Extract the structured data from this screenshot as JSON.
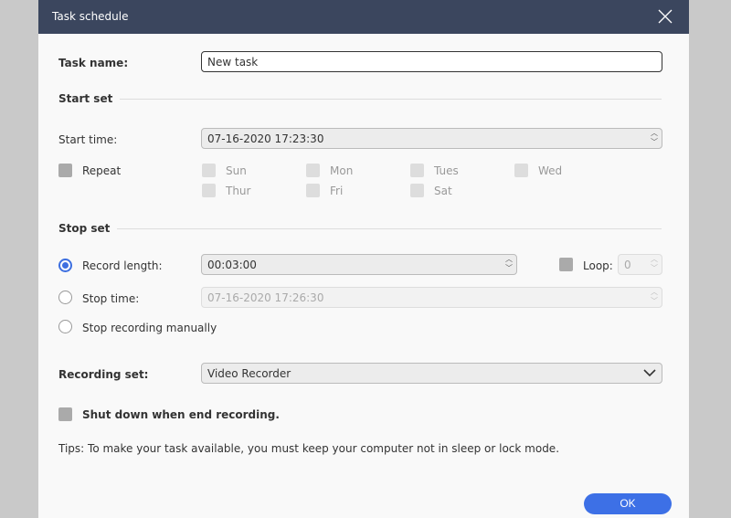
{
  "window": {
    "title": "Task schedule"
  },
  "task_name": {
    "label": "Task name:",
    "value": "New task"
  },
  "start_set": {
    "heading": "Start set",
    "start_time_label": "Start time:",
    "start_time_value": "07-16-2020 17:23:30",
    "repeat_label": "Repeat",
    "days": [
      "Sun",
      "Mon",
      "Tues",
      "Wed",
      "Thur",
      "Fri",
      "Sat"
    ]
  },
  "stop_set": {
    "heading": "Stop set",
    "record_length_label": "Record length:",
    "record_length_value": "00:03:00",
    "loop_label": "Loop:",
    "loop_value": "0",
    "stop_time_label": "Stop time:",
    "stop_time_value": "07-16-2020 17:26:30",
    "manual_label": "Stop recording manually",
    "selected": "record_length"
  },
  "recording_set": {
    "label": "Recording set:",
    "value": "Video Recorder"
  },
  "shutdown_label": "Shut down when end recording.",
  "tips": "Tips: To make your task available, you must keep your computer not in sleep or lock mode.",
  "ok_label": "OK",
  "colors": {
    "header": "#3b465e",
    "accent": "#3d70e6"
  }
}
